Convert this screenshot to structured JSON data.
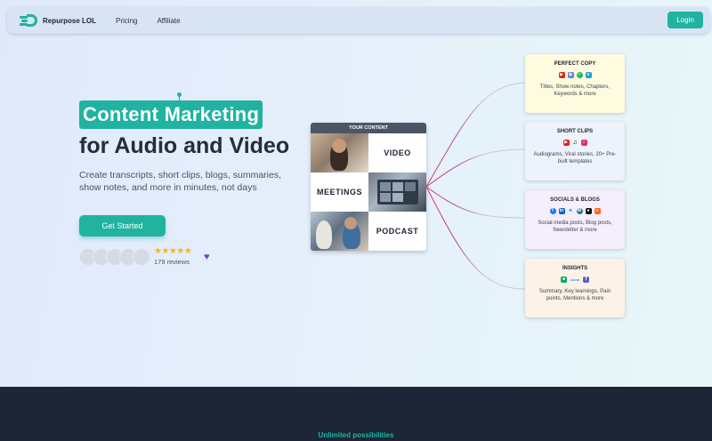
{
  "nav": {
    "brand": "Repurpose LOL",
    "links": [
      "Pricing",
      "Affiliate"
    ],
    "login": "Login"
  },
  "hero": {
    "highlight": "Content Marketing",
    "title": "for Audio and Video",
    "subtitle": "Create transcripts, short clips, blogs, summaries, show notes, and more in minutes, not days",
    "cta": "Get Started",
    "rating_stars": "★★★★★",
    "rating_value": 4.5,
    "reviews": "179 reviews"
  },
  "content": {
    "header": "YOUR CONTENT",
    "labels": [
      "VIDEO",
      "MEETINGS",
      "PODCAST"
    ]
  },
  "outputs": [
    {
      "title": "PERFECT COPY",
      "desc": "Titles, Show notes, Chapters, Keywords & more",
      "bg": "#fefbdf",
      "icons": [
        "youtube-icon",
        "podcasts-icon",
        "spotify-icon",
        "vimeo-icon"
      ]
    },
    {
      "title": "SHORT CLIPS",
      "desc": "Audiograms, Viral stories, 20+ Pre-built templates",
      "bg": "#eef2fb",
      "icons": [
        "youtube-icon",
        "tiktok-icon",
        "instagram-icon"
      ]
    },
    {
      "title": "SOCIALS & BLOGS",
      "desc": "Social media posts, Blog posts, Newsletter & more",
      "bg": "#f5eefb",
      "icons": [
        "facebook-icon",
        "linkedin-icon",
        "twitter-icon",
        "wordpress-icon",
        "medium-icon",
        "substack-icon"
      ]
    },
    {
      "title": "INSIGHTS",
      "desc": "Summary, Key learnings, Pain points, Mentions & more",
      "bg": "#fdf2e7",
      "icons": [
        "meet-icon",
        "zoom-icon",
        "teams-icon"
      ]
    }
  ],
  "section": {
    "eyebrow": "Unlimited possibilities"
  },
  "colors": {
    "accent": "#1fb3a0",
    "dark": "#1e2537",
    "heart": "#7a3ddb",
    "star": "#f5b820"
  }
}
